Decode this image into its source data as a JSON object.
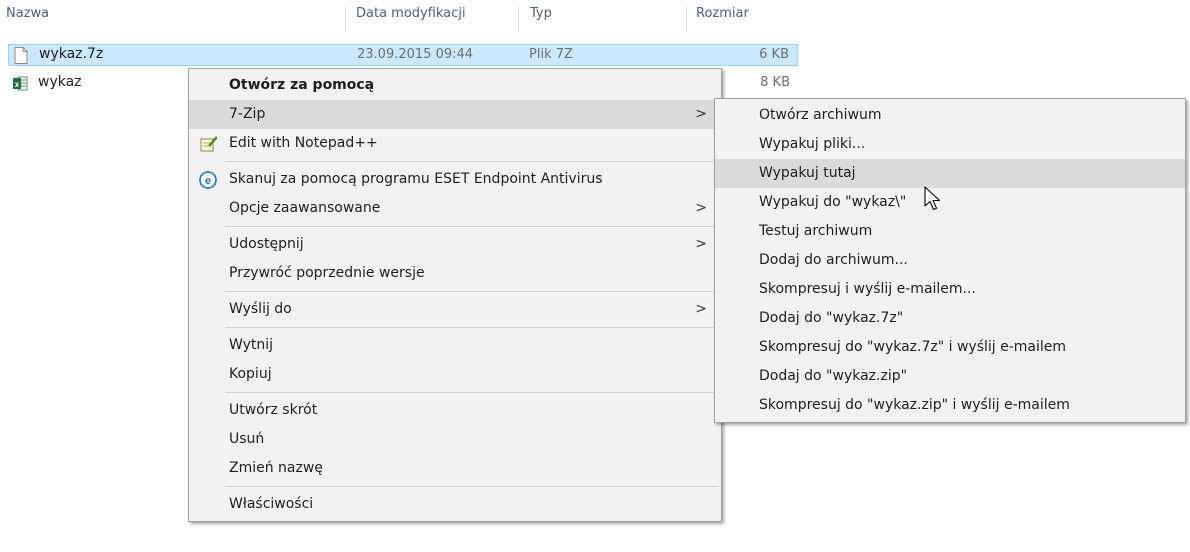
{
  "columns": {
    "name": "Nazwa",
    "date": "Data modyfikacji",
    "type": "Typ",
    "size": "Rozmiar"
  },
  "files": [
    {
      "name": "wykaz.7z",
      "date": "23.09.2015 09:44",
      "type": "Plik 7Z",
      "size": "6 KB",
      "icon": "file-icon"
    },
    {
      "name": "wykaz",
      "date": "",
      "type": "",
      "size": "8 KB",
      "icon": "excel-icon"
    }
  ],
  "context_menu": {
    "open_with": "Otwórz za pomocą",
    "seven_zip": "7-Zip",
    "edit_notepad": "Edit with Notepad++",
    "eset_scan": "Skanuj za pomocą programu ESET Endpoint Antivirus",
    "advanced": "Opcje zaawansowane",
    "share": "Udostępnij",
    "restore": "Przywróć poprzednie wersje",
    "send_to": "Wyślij do",
    "cut": "Wytnij",
    "copy": "Kopiuj",
    "shortcut": "Utwórz skrót",
    "delete": "Usuń",
    "rename": "Zmień nazwę",
    "properties": "Właściwości"
  },
  "seven_zip_menu": {
    "open_archive": "Otwórz archiwum",
    "extract_files": "Wypakuj pliki...",
    "extract_here": "Wypakuj tutaj",
    "extract_to": "Wypakuj do \"wykaz\\\"",
    "test_archive": "Testuj archiwum",
    "add_to_archive": "Dodaj do archiwum...",
    "compress_email": "Skompresuj i wyślij e-mailem...",
    "add_to_7z": "Dodaj do \"wykaz.7z\"",
    "compress_7z_email": "Skompresuj do \"wykaz.7z\" i wyślij e-mailem",
    "add_to_zip": "Dodaj do \"wykaz.zip\"",
    "compress_zip_email": "Skompresuj do \"wykaz.zip\" i wyślij e-mailem"
  },
  "colors": {
    "selection": "#cce8ff",
    "menu_bg": "#f2f2f2",
    "menu_hover": "#dadada",
    "eset_blue": "#1a73c8",
    "excel_green": "#1e7145"
  }
}
